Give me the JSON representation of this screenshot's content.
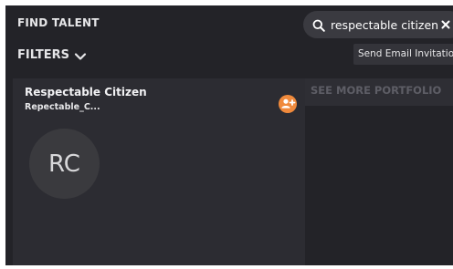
{
  "header": {
    "title": "FIND TALENT"
  },
  "search": {
    "value": "respectable citizen",
    "icon": "search-icon",
    "clear_icon": "close-icon"
  },
  "filters": {
    "label": "FILTERS",
    "icon": "chevron-down-icon"
  },
  "actions": {
    "send_email_label": "Send Email Invitation"
  },
  "result_card": {
    "name": "Respectable Citizen",
    "username": "Repectable_C...",
    "avatar_initials": "RC",
    "add_icon": "add-user-icon"
  },
  "portfolio": {
    "label": "SEE MORE PORTFOLIO"
  },
  "colors": {
    "background": "#232328",
    "card": "#2c2c32",
    "accent": "#f08a3c",
    "search_bg": "#3a3a40"
  }
}
